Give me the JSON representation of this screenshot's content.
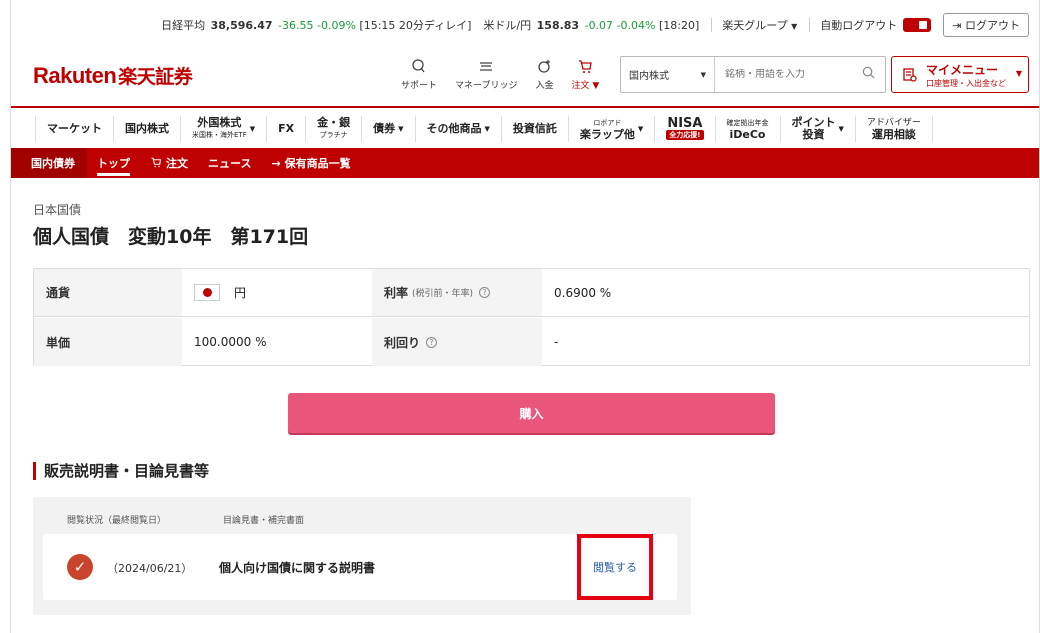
{
  "ticker": {
    "nikkei_label": "日経平均",
    "nikkei_value": "38,596.47",
    "nikkei_change": "-36.55",
    "nikkei_pct": "-0.09%",
    "nikkei_time": "[15:15 20分ディレイ]",
    "usdjpy_label": "米ドル/円",
    "usdjpy_value": "158.83",
    "usdjpy_change": "-0.07",
    "usdjpy_pct": "-0.04%",
    "usdjpy_time": "[18:20]",
    "group_label": "楽天グループ",
    "auto_logout_label": "自動ログアウト",
    "logout_label": "ログアウト",
    "change_color": "#1a9d3a"
  },
  "header": {
    "logo_en": "Rakuten",
    "logo_jp": "楽天証券",
    "brand_color": "#bf0000",
    "icons": [
      {
        "label": "サポート",
        "icon": "support-icon"
      },
      {
        "label": "マネーブリッジ",
        "icon": "bank-icon"
      },
      {
        "label": "入金",
        "icon": "deposit-icon"
      },
      {
        "label": "注文 ▼",
        "icon": "cart-icon"
      }
    ],
    "search_select": "国内株式",
    "search_placeholder": "銘柄・用語を入力",
    "mymenu_title": "マイメニュー",
    "mymenu_sub": "口座管理・入出金など"
  },
  "nav": {
    "market": "マーケット",
    "domestic": "国内株式",
    "foreign": "外国株式",
    "foreign_sub": "米国株・海外ETF",
    "fx": "FX",
    "gold": "金・銀",
    "gold_sub": "プラチナ",
    "bonds": "債券",
    "other": "その他商品",
    "trust": "投資信託",
    "robo_sub": "ロボアド",
    "robo": "楽ラップ他",
    "nisa": "NISA",
    "nisa_badge": "全力応援!",
    "ideco_sub": "確定拠出年金",
    "ideco": "iDeCo",
    "point": "ポイント",
    "point_sub": "投資",
    "advisor": "アドバイザー",
    "advisor_sub": "運用相談"
  },
  "subnav": {
    "section": "国内債券",
    "top": "トップ",
    "order": "注文",
    "news": "ニュース",
    "holdings": "保有商品一覧"
  },
  "product": {
    "category": "日本国債",
    "name": "個人国債　変動10年　第171回"
  },
  "info": {
    "currency_label": "通貨",
    "currency_value": "円",
    "rate_label": "利率",
    "rate_note": "(税引前・年率)",
    "rate_value": "0.6900 %",
    "price_label": "単価",
    "price_value": "100.0000 %",
    "yield_label": "利回り",
    "yield_value": "-"
  },
  "buy_label": "購入",
  "documents": {
    "title": "販売説明書・目論見書等",
    "col_status": "閲覧状況（最終閲覧日）",
    "col_doc": "目論見書・補完書面",
    "rows": [
      {
        "date": "（2024/06/21）",
        "name": "個人向け国債に関する説明書",
        "action": "閲覧する"
      }
    ]
  }
}
